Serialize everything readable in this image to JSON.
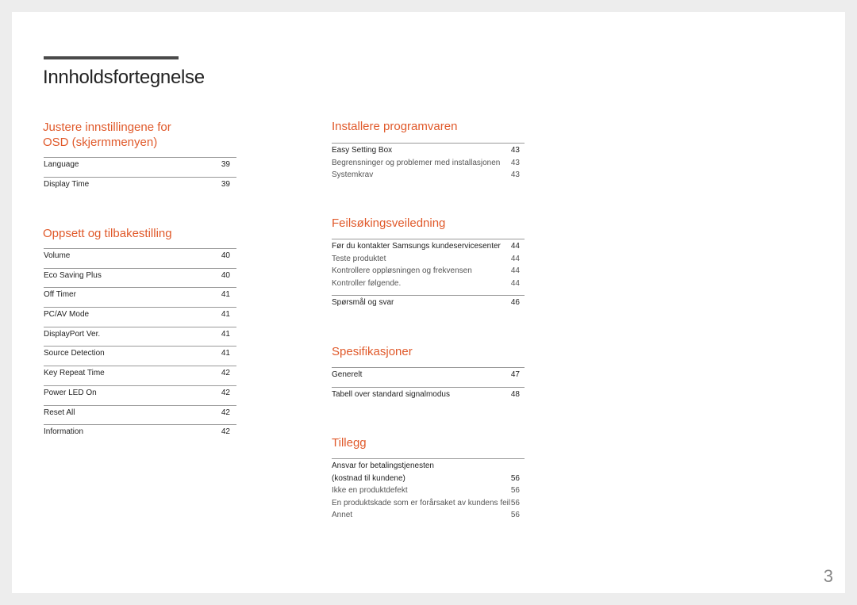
{
  "title": "Innholdsfortegnelse",
  "page_number": "3",
  "accent_color": "#e0592a",
  "left_sections": [
    {
      "heading": [
        "Justere innstillingene for",
        "OSD (skjermmenyen)"
      ],
      "entries": [
        {
          "label": "Language",
          "page": "39"
        },
        {
          "label": "Display Time",
          "page": "39"
        }
      ]
    },
    {
      "heading": [
        "Oppsett og tilbakestilling"
      ],
      "entries": [
        {
          "label": "Volume",
          "page": "40"
        },
        {
          "label": "Eco Saving Plus",
          "page": "40"
        },
        {
          "label": "Off Timer",
          "page": "41"
        },
        {
          "label": "PC/AV Mode",
          "page": "41"
        },
        {
          "label": "DisplayPort Ver.",
          "page": "41"
        },
        {
          "label": "Source Detection",
          "page": "41"
        },
        {
          "label": "Key Repeat Time",
          "page": "42"
        },
        {
          "label": "Power LED On",
          "page": "42"
        },
        {
          "label": "Reset All",
          "page": "42"
        },
        {
          "label": "Information",
          "page": "42"
        }
      ]
    }
  ],
  "right_sections": [
    {
      "heading": "Installere programvaren",
      "groups": [
        [
          {
            "label": "Easy Setting Box",
            "page": "43",
            "main": true
          },
          {
            "label": "Begrensninger og problemer med installasjonen",
            "page": "43"
          },
          {
            "label": "Systemkrav",
            "page": "43"
          }
        ]
      ]
    },
    {
      "heading": "Feilsøkingsveiledning",
      "groups": [
        [
          {
            "label": "Før du kontakter Samsungs kundeservicesenter",
            "page": "44",
            "main": true
          },
          {
            "label": "Teste produktet",
            "page": "44"
          },
          {
            "label": "Kontrollere oppløsningen og frekvensen",
            "page": "44"
          },
          {
            "label": "Kontroller følgende.",
            "page": "44"
          }
        ],
        [
          {
            "label": "Spørsmål og svar",
            "page": "46",
            "main": true
          }
        ]
      ]
    },
    {
      "heading": "Spesifikasjoner",
      "groups": [
        [
          {
            "label": "Generelt",
            "page": "47",
            "main": true
          }
        ],
        [
          {
            "label": "Tabell over standard signalmodus",
            "page": "48",
            "main": true
          }
        ]
      ]
    },
    {
      "heading": "Tillegg",
      "groups": [
        [
          {
            "label": "Ansvar for betalingstjenesten",
            "page": "",
            "main": true
          },
          {
            "label": "(kostnad til kundene)",
            "page": "56",
            "main": true
          },
          {
            "label": "Ikke en produktdefekt",
            "page": "56"
          },
          {
            "label": "En produktskade som er forårsaket av kundens feil",
            "page": "56"
          },
          {
            "label": "Annet",
            "page": "56"
          }
        ]
      ]
    }
  ]
}
